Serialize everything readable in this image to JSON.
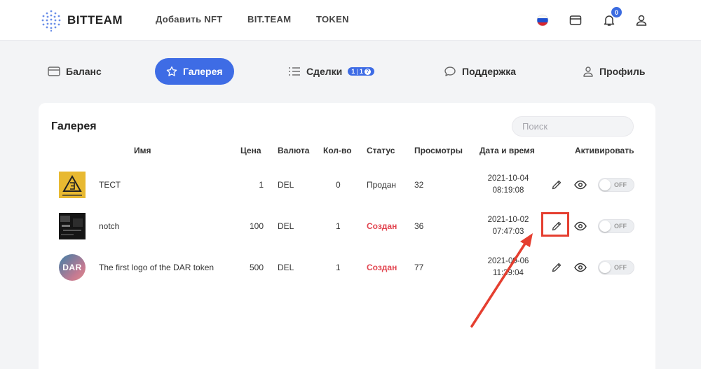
{
  "header": {
    "logo_text": "BITTEAM",
    "nav": [
      "Добавить NFT",
      "BIT.TEAM",
      "TOKEN"
    ],
    "notifications_count": "0"
  },
  "tabs": [
    {
      "label": "Баланс",
      "icon": "wallet-icon"
    },
    {
      "label": "Галерея",
      "icon": "star-icon",
      "active": true
    },
    {
      "label": "Сделки",
      "icon": "list-icon",
      "badge_a": "1",
      "badge_b": "1"
    },
    {
      "label": "Поддержка",
      "icon": "chat-icon"
    },
    {
      "label": "Профиль",
      "icon": "user-icon"
    }
  ],
  "gallery": {
    "title": "Галерея",
    "search_placeholder": "Поиск",
    "columns": [
      "Имя",
      "Цена",
      "Валюта",
      "Кол-во",
      "Статус",
      "Просмотры",
      "Дата и время",
      "Активировать"
    ],
    "rows": [
      {
        "name": "ТЕСТ",
        "price": "1",
        "currency": "DEL",
        "qty": "0",
        "status": "Продан",
        "views": "32",
        "date": "2021-10-04",
        "time": "08:19:08",
        "toggle": "OFF",
        "thumb": "thumb-test"
      },
      {
        "name": "notch",
        "price": "100",
        "currency": "DEL",
        "qty": "1",
        "status": "Создан",
        "views": "36",
        "date": "2021-10-02",
        "time": "07:47:03",
        "toggle": "OFF",
        "thumb": "thumb-notch"
      },
      {
        "name": "The first logo of the DAR token",
        "price": "500",
        "currency": "DEL",
        "qty": "1",
        "status": "Создан",
        "views": "77",
        "date": "2021-09-06",
        "time": "11:39:04",
        "toggle": "OFF",
        "thumb": "thumb-dar"
      }
    ],
    "thumb_text_dar": "DAR"
  },
  "colors": {
    "accent": "#3e6ce5",
    "status_created": "#e2444f",
    "annotation": "#e53f30"
  }
}
